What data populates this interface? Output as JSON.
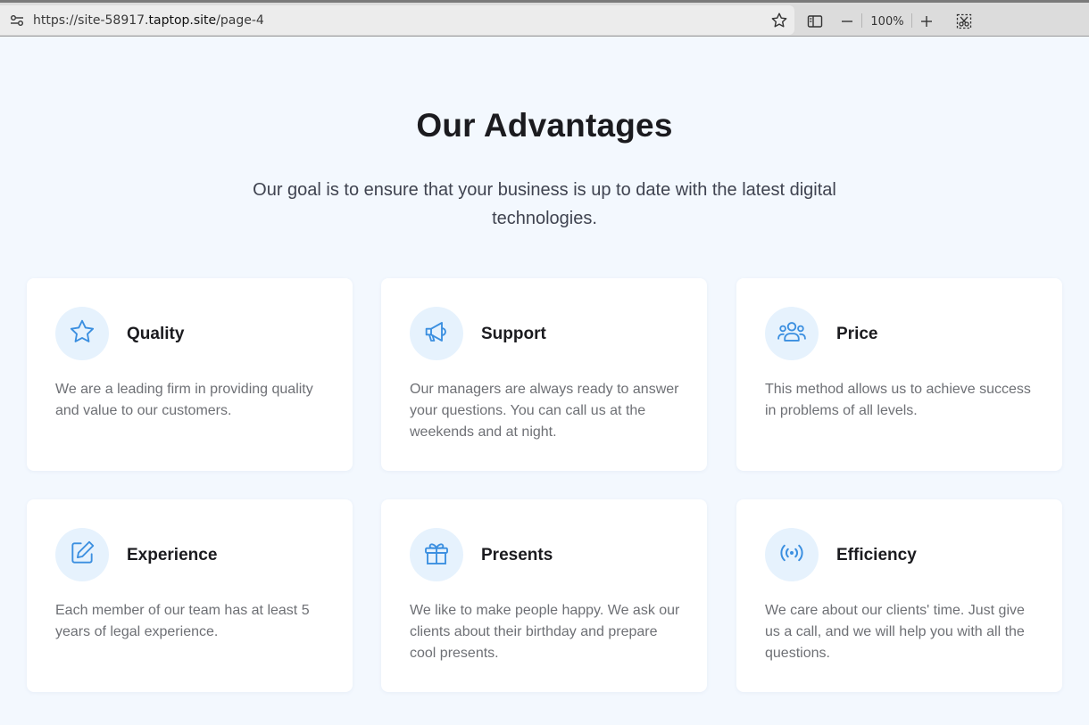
{
  "browser": {
    "url_prefix": "https://site-58917.",
    "url_domain": "taptop.site",
    "url_path": "/page-4",
    "zoom": "100%"
  },
  "section": {
    "title": "Our Advantages",
    "subtitle": "Our goal is to ensure that your business is up to date with the latest digital technologies."
  },
  "colors": {
    "accent": "#3b8fe0",
    "icon_bg": "#e6f2fd",
    "page_bg": "#f3f8fe"
  },
  "cards": [
    {
      "title": "Quality",
      "icon": "star-icon",
      "text": "We are a leading firm in providing quality and value to our customers."
    },
    {
      "title": "Support",
      "icon": "megaphone-icon",
      "text": "Our managers are always ready to answer your questions. You can call us at the weekends and at night."
    },
    {
      "title": "Price",
      "icon": "users-icon",
      "text": "This method allows us to achieve success in problems of all levels."
    },
    {
      "title": "Experience",
      "icon": "edit-icon",
      "text": "Each member of our team has at least 5 years of legal experience."
    },
    {
      "title": "Presents",
      "icon": "gift-icon",
      "text": "We like to make people happy. We ask our clients about their birthday and prepare cool presents."
    },
    {
      "title": "Efficiency",
      "icon": "broadcast-icon",
      "text": "We care about our clients' time. Just give us a call, and we will help you with all the questions."
    }
  ]
}
